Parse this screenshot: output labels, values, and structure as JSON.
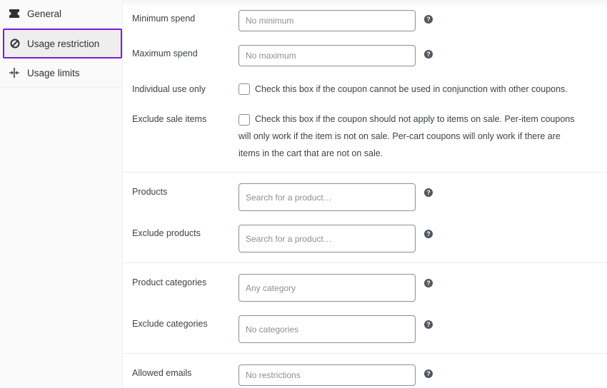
{
  "sidebar": {
    "tabs": [
      {
        "label": "General"
      },
      {
        "label": "Usage restriction"
      },
      {
        "label": "Usage limits"
      }
    ]
  },
  "form": {
    "minimum_spend": {
      "label": "Minimum spend",
      "placeholder": "No minimum"
    },
    "maximum_spend": {
      "label": "Maximum spend",
      "placeholder": "No maximum"
    },
    "individual_use": {
      "label": "Individual use only",
      "description": "Check this box if the coupon cannot be used in conjunction with other coupons."
    },
    "exclude_sale": {
      "label": "Exclude sale items",
      "line1": "Check this box if the coupon should not apply to items on sale. Per-item coupons",
      "line2": "will only work if the item is not on sale. Per-cart coupons will only work if there are",
      "line3": "items in the cart that are not on sale."
    },
    "products": {
      "label": "Products",
      "placeholder": "Search for a product…"
    },
    "exclude_products": {
      "label": "Exclude products",
      "placeholder": "Search for a product…"
    },
    "product_categories": {
      "label": "Product categories",
      "placeholder": "Any category"
    },
    "exclude_categories": {
      "label": "Exclude categories",
      "placeholder": "No categories"
    },
    "allowed_emails": {
      "label": "Allowed emails",
      "placeholder": "No restrictions"
    },
    "help_glyph": "?"
  }
}
